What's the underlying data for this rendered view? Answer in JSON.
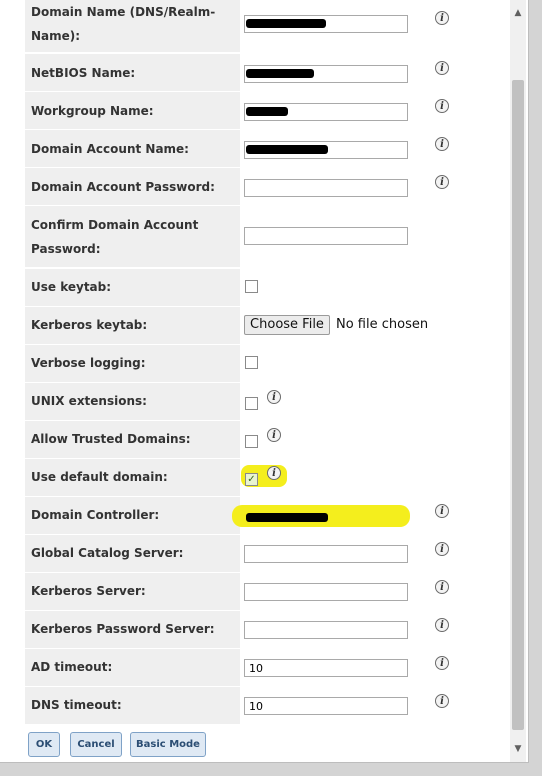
{
  "form": {
    "rows": [
      {
        "label": "Domain Name (DNS/Realm-Name):",
        "type": "text-redacted"
      },
      {
        "label": "NetBIOS Name:",
        "type": "text-redacted"
      },
      {
        "label": "Workgroup Name:",
        "type": "text-redacted"
      },
      {
        "label": "Domain Account Name:",
        "type": "text-redacted"
      },
      {
        "label": "Domain Account Password:",
        "type": "password"
      },
      {
        "label": "Confirm Domain Account Password:",
        "type": "password"
      },
      {
        "label": "Use keytab:",
        "type": "checkbox",
        "checked": false
      },
      {
        "label": "Kerberos keytab:",
        "type": "file"
      },
      {
        "label": "Verbose logging:",
        "type": "checkbox",
        "checked": false
      },
      {
        "label": "UNIX extensions:",
        "type": "checkbox",
        "checked": false
      },
      {
        "label": "Allow Trusted Domains:",
        "type": "checkbox",
        "checked": false
      },
      {
        "label": "Use default domain:",
        "type": "checkbox",
        "checked": true
      },
      {
        "label": "Domain Controller:",
        "type": "text-redacted"
      },
      {
        "label": "Global Catalog Server:",
        "type": "text"
      },
      {
        "label": "Kerberos Server:",
        "type": "text"
      },
      {
        "label": "Kerberos Password Server:",
        "type": "text"
      },
      {
        "label": "AD timeout:",
        "type": "text",
        "value": "10"
      },
      {
        "label": "DNS timeout:",
        "type": "text",
        "value": "10"
      }
    ],
    "file": {
      "button_label": "Choose File",
      "status": "No file chosen"
    },
    "info_icon_glyph": "i"
  },
  "buttons": {
    "ok": "OK",
    "cancel": "Cancel",
    "basic_mode": "Basic Mode"
  },
  "colors": {
    "label_bg": "#efefef",
    "highlight": "#f4ee1d",
    "button_text": "#2b4d73"
  }
}
